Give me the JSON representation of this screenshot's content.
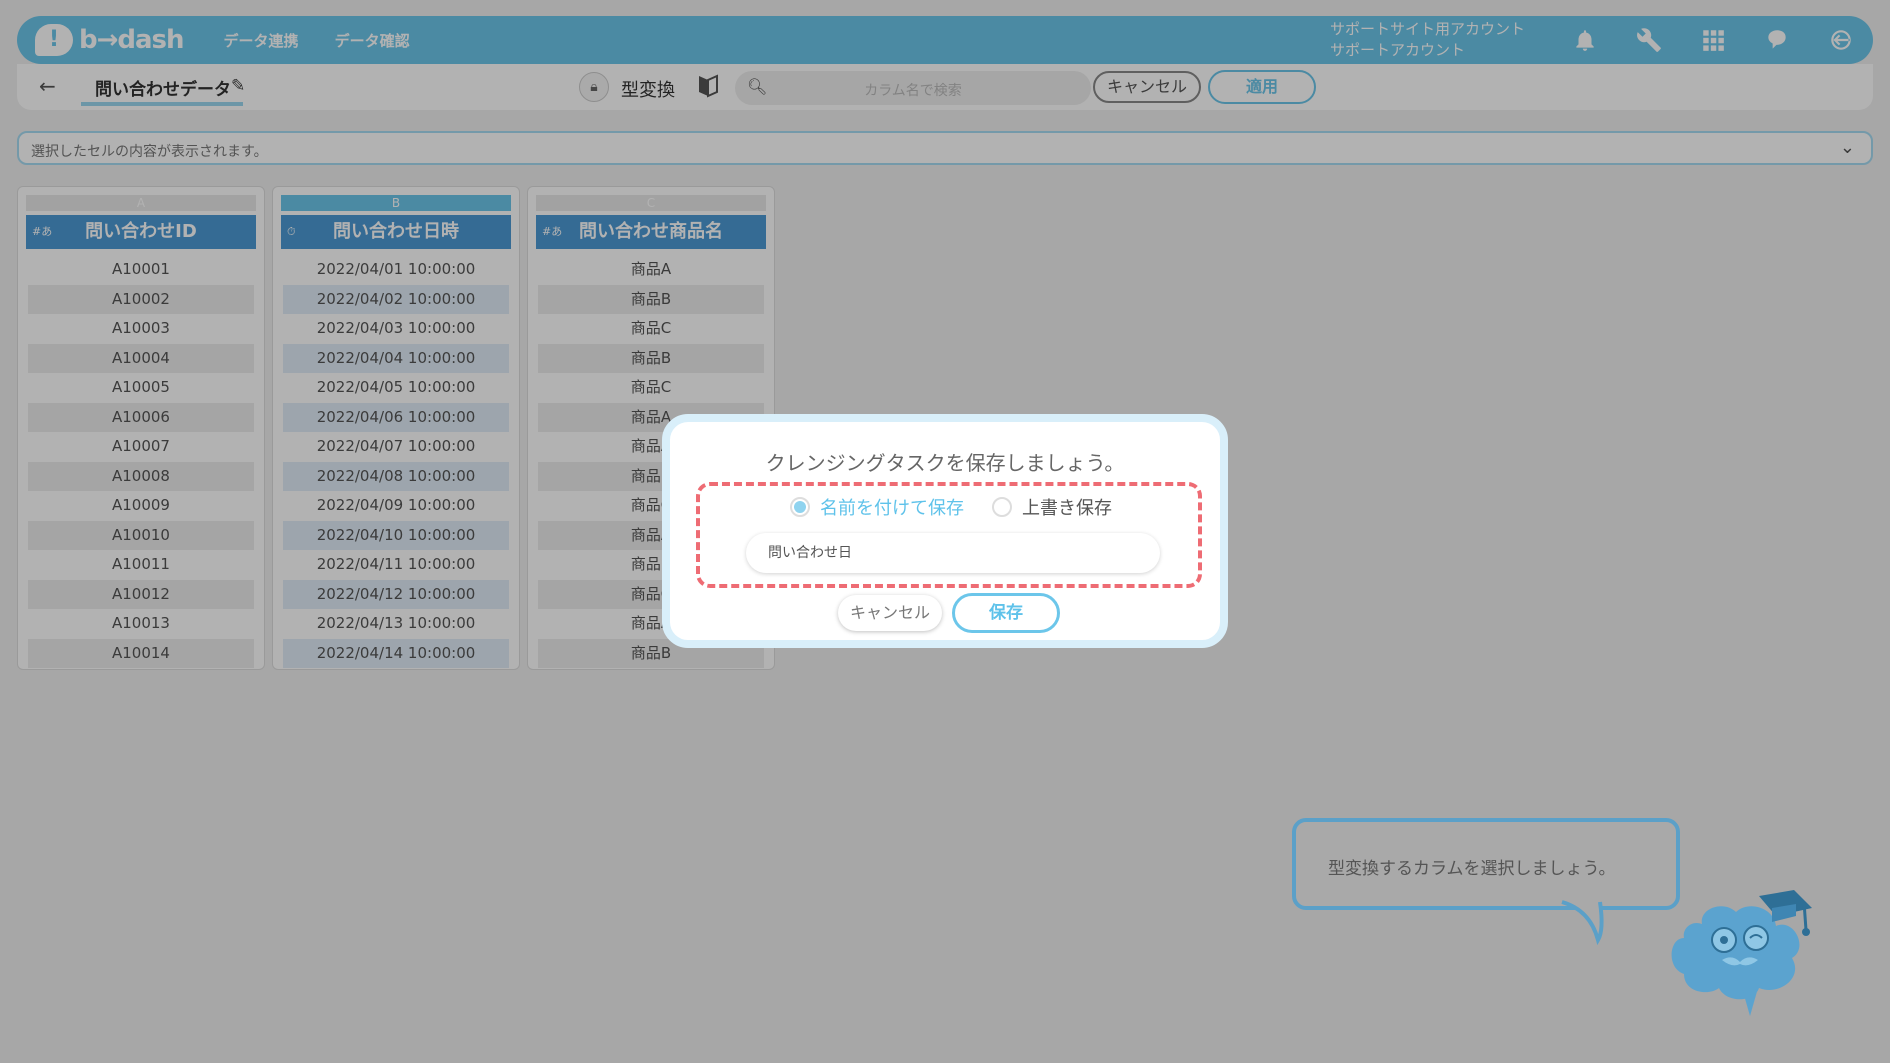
{
  "header": {
    "logo_text": "b→dash",
    "nav": [
      "データ連携",
      "データ確認"
    ],
    "account_line1": "サポートサイト用アカウント",
    "account_line2": "サポートアカウント",
    "icons": [
      "bell-icon",
      "wrench-icon",
      "grid-icon",
      "help-brain-icon",
      "logout-icon"
    ]
  },
  "toolbar": {
    "dataset_name": "問い合わせデータ",
    "conversion_title": "型変換",
    "search_placeholder": "カラム名で検索",
    "cancel_label": "キャンセル",
    "apply_label": "適用"
  },
  "cell_display": {
    "placeholder": "選択したセルの内容が表示されます。"
  },
  "columns": [
    {
      "letter": "A",
      "type_icon": "#あ",
      "name": "問い合わせID",
      "rows": [
        "A10001",
        "A10002",
        "A10003",
        "A10004",
        "A10005",
        "A10006",
        "A10007",
        "A10008",
        "A10009",
        "A10010",
        "A10011",
        "A10012",
        "A10013",
        "A10014"
      ]
    },
    {
      "letter": "B",
      "type_icon": "⏱",
      "name": "問い合わせ日時",
      "rows": [
        "2022/04/01 10:00:00",
        "2022/04/02 10:00:00",
        "2022/04/03 10:00:00",
        "2022/04/04 10:00:00",
        "2022/04/05 10:00:00",
        "2022/04/06 10:00:00",
        "2022/04/07 10:00:00",
        "2022/04/08 10:00:00",
        "2022/04/09 10:00:00",
        "2022/04/10 10:00:00",
        "2022/04/11 10:00:00",
        "2022/04/12 10:00:00",
        "2022/04/13 10:00:00",
        "2022/04/14 10:00:00"
      ]
    },
    {
      "letter": "C",
      "type_icon": "#あ",
      "name": "問い合わせ商品名",
      "rows": [
        "商品A",
        "商品B",
        "商品C",
        "商品B",
        "商品C",
        "商品A",
        "商品A",
        "商品B",
        "商品C",
        "商品A",
        "商品B",
        "商品C",
        "商品A",
        "商品B"
      ]
    }
  ],
  "dialog": {
    "title": "クレンジングタスクを保存しましょう。",
    "option_save_as": "名前を付けて保存",
    "option_overwrite": "上書き保存",
    "selected_option": "名前を付けて保存",
    "name_value": "問い合わせ日",
    "cancel_label": "キャンセル",
    "save_label": "保存"
  },
  "tutorial": {
    "bubble_text": "型変換するカラムを選択しましょう。"
  },
  "colors": {
    "brand": "#6cc6ea",
    "column_header": "#4c9ad4",
    "highlight_dash": "#ee6c74"
  }
}
